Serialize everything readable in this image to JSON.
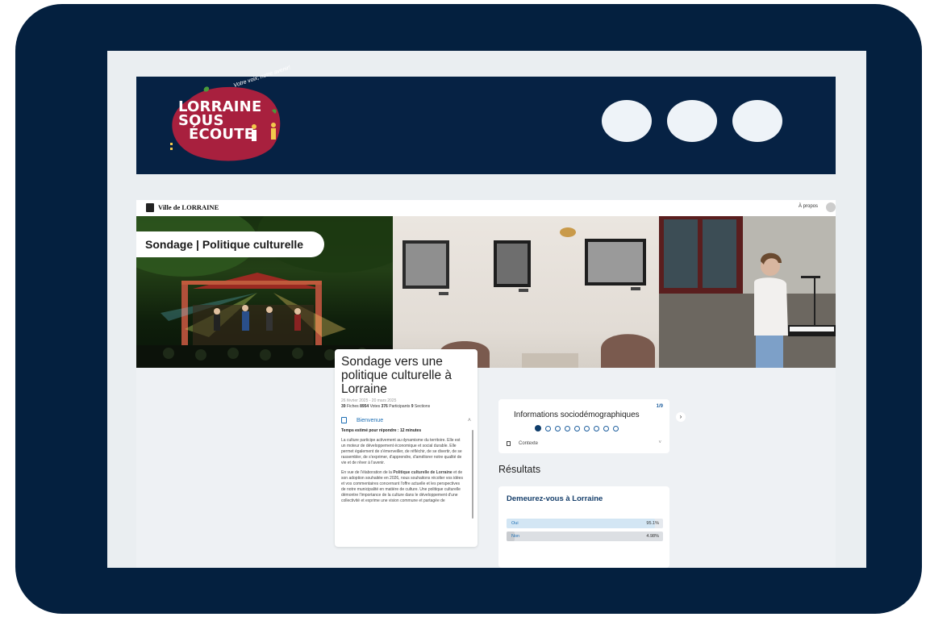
{
  "logo": {
    "line1": "LORRAINE",
    "line2": "SOUS",
    "line3": "ÉCOUTE",
    "tagline": "Votre voix, notre avenir!",
    "color_primary": "#a8203e"
  },
  "banner_dots": 3,
  "topbar": {
    "site_name": "Ville de LORRAINE",
    "about_link": "À propos"
  },
  "hero": {
    "title_pill": "Sondage | Politique culturelle"
  },
  "survey": {
    "title": "Sondage vers une politique culturelle à Lorraine",
    "dates": "26 février 2025 - 20 mars 2025",
    "stats": {
      "fiches_count": "39",
      "fiches_label": "Fiches",
      "votes_count": "8954",
      "votes_label": "Votes",
      "participants_count": "376",
      "participants_label": "Participants",
      "sections_count": "9",
      "sections_label": "Sections"
    },
    "section_label": "Bienvenue",
    "estimated_time": "Temps estimé pour répondre : 12 minutes",
    "paragraph1": "La culture participe activement au dynamisme du territoire. Elle est un moteur de développement économique et social durable. Elle permet également de s'émerveiller, de réfléchir, de se divertir, de se rassembler, de s'exprimer, d'apprendre, d'améliorer notre qualité de vie et de rêver à l'avenir.",
    "paragraph2_pre": "En vue de l'élaboration de la ",
    "paragraph2_bold": "Politique culturelle de Lorraine",
    "paragraph2_post": " et de son adoption souhaitée en 2026, nous souhaitons récolter vos idées et vos commentaires concernant l'offre actuelle et les perspectives de notre municipalité en matière de culture. Une politique culturelle démontre l'importance de la culture dans le développement d'une collectivité et exprime une vision commune et partagée de"
  },
  "socio": {
    "counter": "1/9",
    "title": "Informations sociodémographiques",
    "pages_total": 9,
    "page_current": 1,
    "context_label": "Contexte"
  },
  "results": {
    "heading": "Résultats",
    "question": "Demeurez-vous à Lorraine",
    "answers": [
      {
        "label": "Oui",
        "percent_text": "95.1%",
        "value": 95.1
      },
      {
        "label": "Non",
        "percent_text": "4.98%",
        "value": 4.98
      }
    ]
  },
  "colors": {
    "device_frame": "#04203f",
    "banner": "#062244",
    "accent": "#1e6fb4",
    "question_title": "#163f6b"
  },
  "icons": {
    "next": "chevron-right-icon",
    "expand": "chevron-up-icon",
    "collapse": "chevron-down-icon",
    "document": "document-icon"
  }
}
